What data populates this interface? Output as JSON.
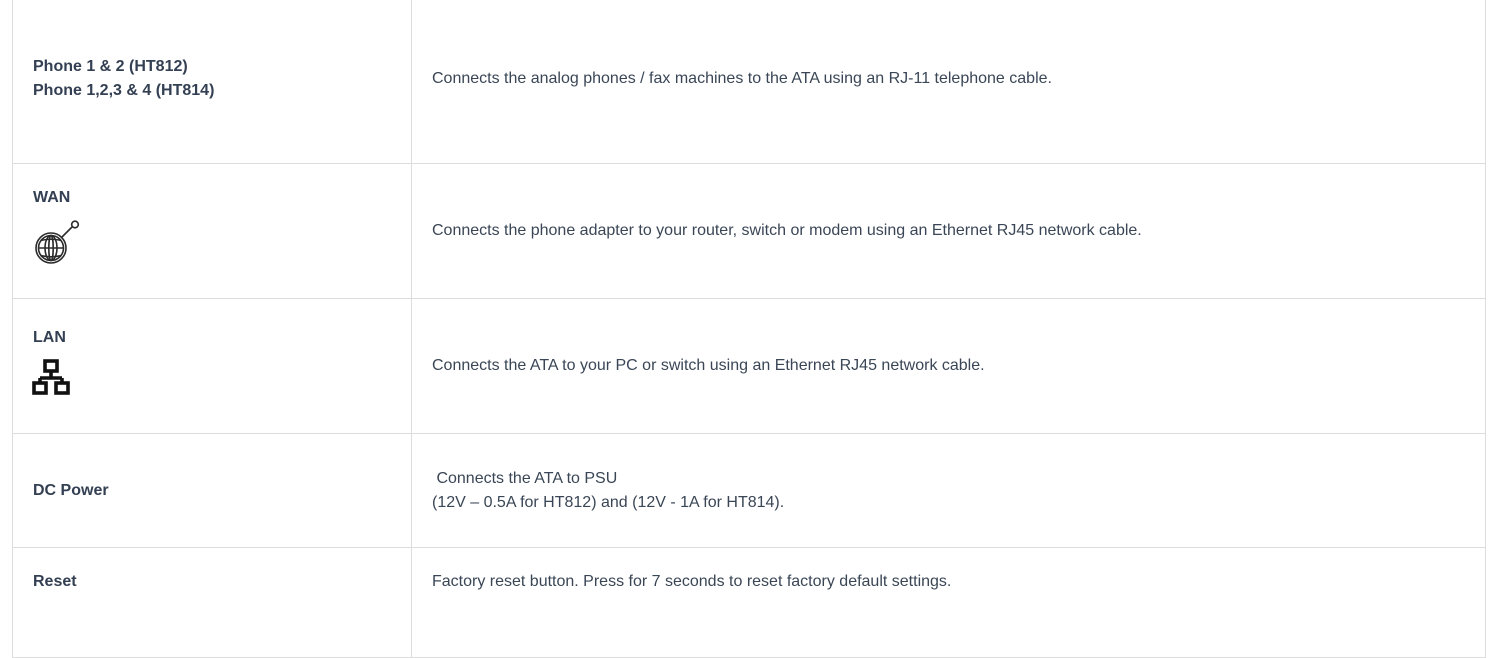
{
  "rows": [
    {
      "label_lines": [
        "Phone 1 & 2 (HT812)",
        "Phone 1,2,3 & 4 (HT814)"
      ],
      "icon": null,
      "description_lines": [
        "Connects the analog phones / fax machines to the ATA using an RJ-11 telephone cable."
      ]
    },
    {
      "label_lines": [
        "WAN"
      ],
      "icon": "globe-network-icon",
      "description_lines": [
        "Connects the phone adapter to your router, switch or modem using an Ethernet RJ45 network cable."
      ]
    },
    {
      "label_lines": [
        "LAN"
      ],
      "icon": "lan-network-icon",
      "description_lines": [
        "Connects the ATA to your PC or switch using an Ethernet RJ45 network cable."
      ]
    },
    {
      "label_lines": [
        "DC Power"
      ],
      "icon": null,
      "description_lines": [
        " Connects the ATA to PSU",
        "(12V – 0.5A for HT812) and (12V - 1A for HT814)."
      ]
    },
    {
      "label_lines": [
        "Reset"
      ],
      "icon": null,
      "description_lines": [
        "Factory reset button. Press for 7 seconds to reset factory default settings."
      ]
    }
  ],
  "colors": {
    "border": "#dcdcdc",
    "label_text": "#333f52",
    "body_text": "#3a4656",
    "icon": "#2b2b2b"
  }
}
